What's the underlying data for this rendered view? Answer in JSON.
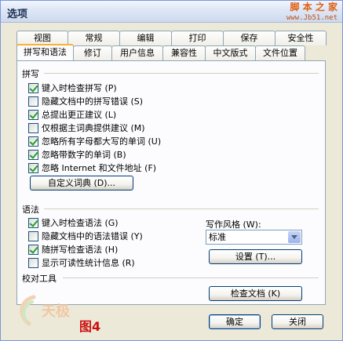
{
  "window": {
    "title": "选项"
  },
  "watermark": {
    "line1": "脚 本 之 家",
    "line2": "www.Jb51.net",
    "logo_text": "天极"
  },
  "tabs": {
    "back_row": [
      {
        "label": "视图"
      },
      {
        "label": "常规"
      },
      {
        "label": "编辑"
      },
      {
        "label": "打印"
      },
      {
        "label": "保存"
      },
      {
        "label": "安全性"
      }
    ],
    "front_row": [
      {
        "label": "拼写和语法",
        "active": true
      },
      {
        "label": "修订"
      },
      {
        "label": "用户信息"
      },
      {
        "label": "兼容性"
      },
      {
        "label": "中文版式"
      },
      {
        "label": "文件位置"
      }
    ]
  },
  "spelling": {
    "heading": "拼写",
    "options": [
      {
        "label": "键入时检查拼写 (P)",
        "checked": true
      },
      {
        "label": "隐藏文档中的拼写错误 (S)",
        "checked": false
      },
      {
        "label": "总提出更正建议 (L)",
        "checked": true
      },
      {
        "label": "仅根据主词典提供建议 (M)",
        "checked": false
      },
      {
        "label": "忽略所有字母都大写的单词 (U)",
        "checked": true
      },
      {
        "label": "忽略带数字的单词 (B)",
        "checked": true
      },
      {
        "label": "忽略 Internet 和文件地址 (F)",
        "checked": true
      }
    ],
    "custom_dict_button": "自定义词典 (D)..."
  },
  "grammar": {
    "heading": "语法",
    "options": [
      {
        "label": "键入时检查语法 (G)",
        "checked": true
      },
      {
        "label": "隐藏文档中的语法错误 (Y)",
        "checked": false
      },
      {
        "label": "随拼写检查语法 (H)",
        "checked": true
      },
      {
        "label": "显示可读性统计信息 (R)",
        "checked": false
      }
    ],
    "style_label": "写作风格 (W):",
    "style_value": "标准",
    "settings_button": "设置 (T)..."
  },
  "proofing": {
    "heading": "校对工具",
    "check_document_button": "检查文档 (K)"
  },
  "footer": {
    "figure_label": "图4",
    "ok_button": "确定",
    "close_button": "关闭"
  }
}
